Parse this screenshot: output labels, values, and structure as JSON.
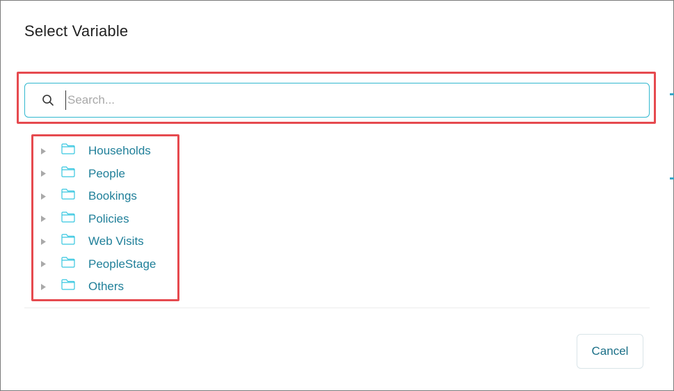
{
  "dialog": {
    "title": "Select Variable"
  },
  "search": {
    "value": "",
    "placeholder": "Search...",
    "icon": "search-icon"
  },
  "tree": {
    "items": [
      {
        "label": "Households",
        "icon": "folder-icon"
      },
      {
        "label": "People",
        "icon": "folder-icon"
      },
      {
        "label": "Bookings",
        "icon": "folder-icon"
      },
      {
        "label": "Policies",
        "icon": "folder-icon"
      },
      {
        "label": "Web Visits",
        "icon": "folder-icon"
      },
      {
        "label": "PeopleStage",
        "icon": "folder-icon"
      },
      {
        "label": "Others",
        "icon": "folder-icon"
      }
    ]
  },
  "footer": {
    "cancel_label": "Cancel"
  },
  "colors": {
    "accent": "#31b8d0",
    "link_text": "#1f7f99",
    "highlight": "#e64a4f",
    "folder": "#36c6e0"
  }
}
